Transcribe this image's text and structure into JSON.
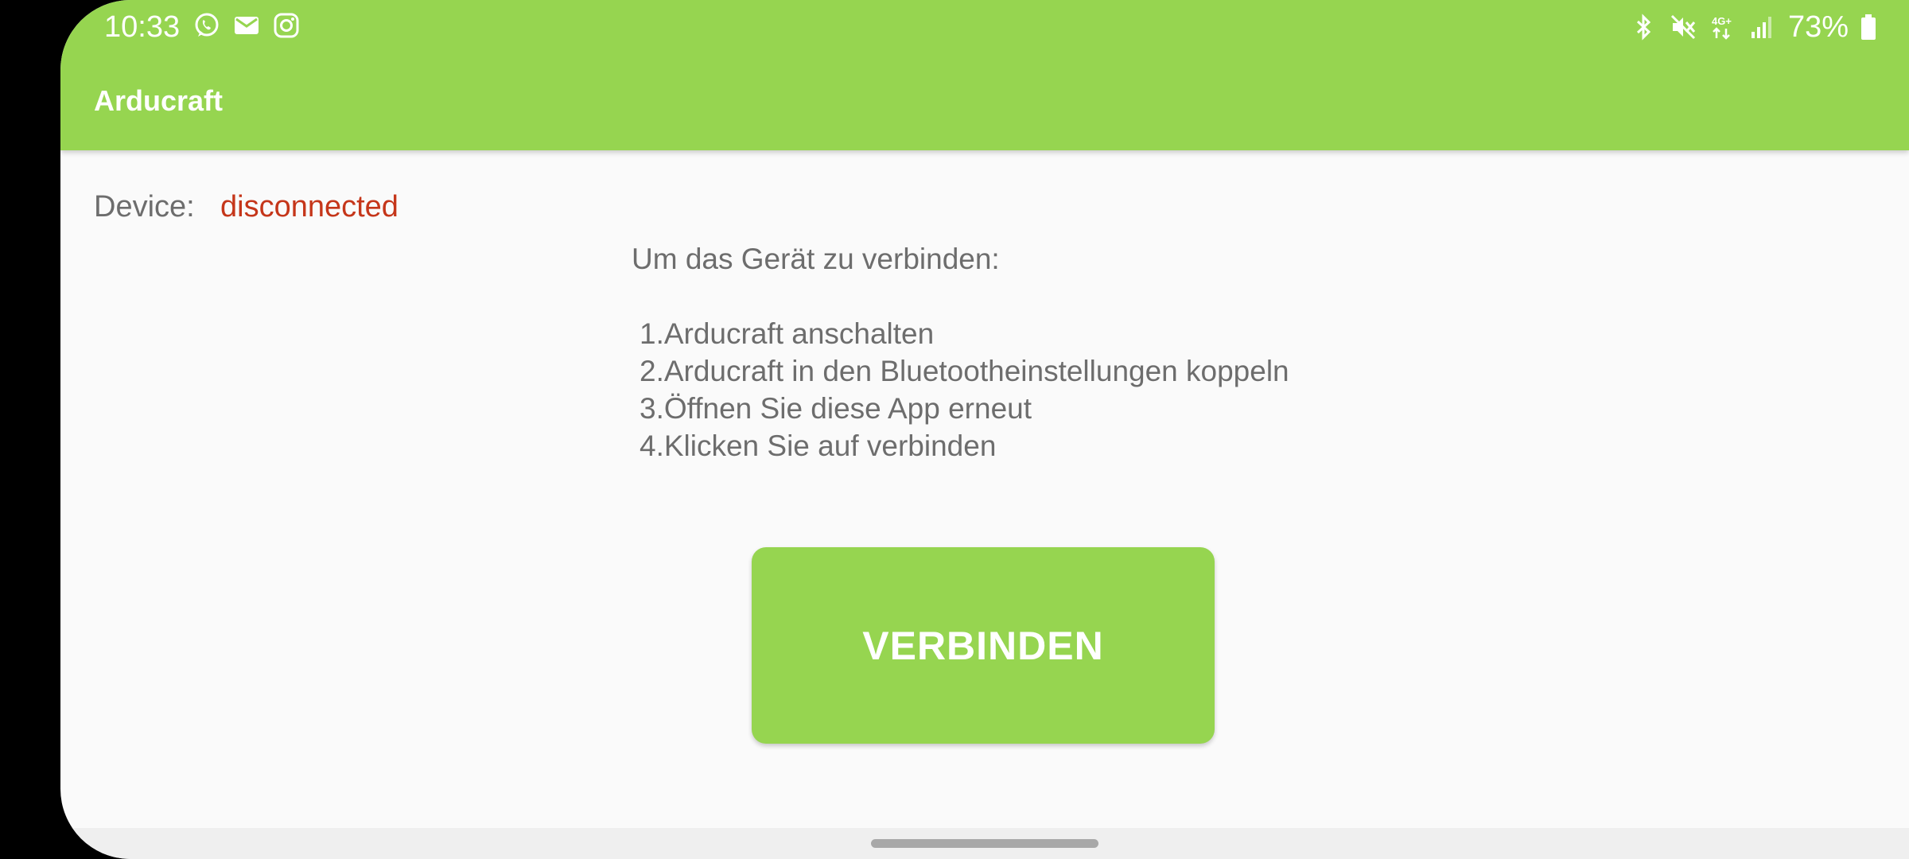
{
  "status_bar": {
    "time": "10:33",
    "left_icons": [
      "whatsapp-icon",
      "email-icon",
      "instagram-icon"
    ],
    "right_icons": [
      "bluetooth-icon",
      "mute-icon",
      "4g-icon",
      "signal-icon",
      "battery-icon"
    ],
    "battery": "73%"
  },
  "app_bar": {
    "title": "Arducraft",
    "color": "#96d550"
  },
  "device": {
    "label": "Device:",
    "status": "disconnected",
    "status_color": "#c5361a"
  },
  "instructions": {
    "heading": "Um das Gerät zu verbinden:",
    "steps": [
      "1.Arducraft anschalten",
      "2.Arducraft in den Bluetootheinstellungen koppeln",
      "3.Öffnen Sie diese App erneut",
      "4.Klicken Sie auf verbinden"
    ]
  },
  "connect_button": {
    "label": "VERBINDEN"
  }
}
